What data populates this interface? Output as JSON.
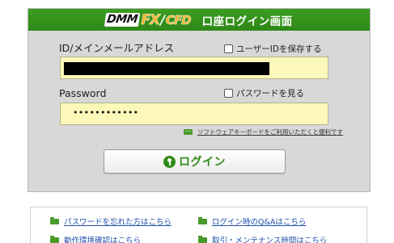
{
  "header": {
    "logo_dmm": "DMM",
    "logo_fx": "FX",
    "logo_slash": "/",
    "logo_cfd": "CFD",
    "title": "口座ログイン画面"
  },
  "form": {
    "id_label": "ID/メインメールアドレス",
    "save_id_label": "ユーザーIDを保存する",
    "password_label": "Password",
    "show_password_label": "パスワードを見る",
    "password_masked": "••••••••••••",
    "keyboard_note": "ソフトウェアキーボードをご利用いただくと便利です",
    "login_button": "ログイン"
  },
  "links": {
    "forgot_password": "パスワードを忘れた方はこちら",
    "qa": "ログイン時のQ&Aはこちら",
    "environment_check": "動作環境確認はこちら",
    "maintenance_hours": "取引・メンテナンス時間はこちら"
  },
  "colors": {
    "header_green": "#3c9c20",
    "accent_orange": "#f7ae1c",
    "input_yellow": "#fbf8b9",
    "button_green_text": "#2f8a1a",
    "link_blue": "#1f4faa"
  }
}
